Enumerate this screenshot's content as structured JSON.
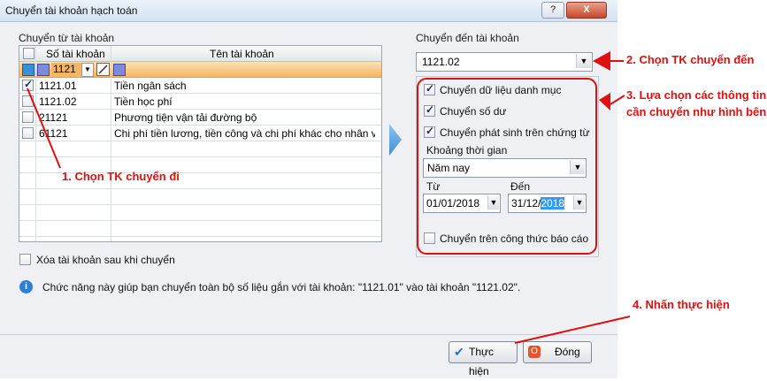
{
  "window": {
    "title": "Chuyển tài khoản hạch toán",
    "help_label": "?",
    "close_label": "X"
  },
  "source": {
    "group_label": "Chuyển từ tài khoản",
    "col_account_no": "Số tài khoản",
    "col_account_name": "Tên tài khoản",
    "filter_value": "1121",
    "rows": [
      {
        "checked": true,
        "account": "1121.01",
        "name": "Tiền ngân sách"
      },
      {
        "checked": false,
        "account": "1121.02",
        "name": "Tiền học phí"
      },
      {
        "checked": false,
        "account": "21121",
        "name": "Phương tiện vận tải đường bộ"
      },
      {
        "checked": false,
        "account": "61121",
        "name": "Chi phí tiền lương, tiền công và chi phí khác cho nhân vi..."
      }
    ],
    "delete_after_label": "Xóa tài khoản sau khi chuyển"
  },
  "target": {
    "group_label": "Chuyển đến tài khoản",
    "account_value": "1121.02",
    "opt_category": "Chuyển dữ liệu danh mục",
    "opt_balance": "Chuyển số dư",
    "opt_transactions": "Chuyển phát sinh trên chứng từ",
    "period_label": "Khoảng thời gian",
    "period_value": "Năm nay",
    "from_label": "Từ",
    "from_value": "01/01/2018",
    "to_label": "Đến",
    "to_value_prefix": "31/12/",
    "to_value_selected": "2018",
    "opt_formula": "Chuyển trên công thức báo cáo"
  },
  "info_text": "Chức năng này giúp bạn chuyển toàn bộ số liệu gắn với tài khoản: \"1121.01\" vào tài khoản \"1121.02\".",
  "buttons": {
    "execute": "Thực hiện",
    "close": "Đóng"
  },
  "annotations": {
    "step1": "1. Chọn TK chuyển đi",
    "step2": "2. Chọn TK chuyển đến",
    "step3_line1": "3. Lựa chọn các thông tin",
    "step3_line2": "cần chuyển như hình bên",
    "step4": "4. Nhấn thực hiện"
  },
  "colors": {
    "annotation": "#e01010",
    "filter_row": "#f6b560",
    "selection": "#3399ff"
  }
}
